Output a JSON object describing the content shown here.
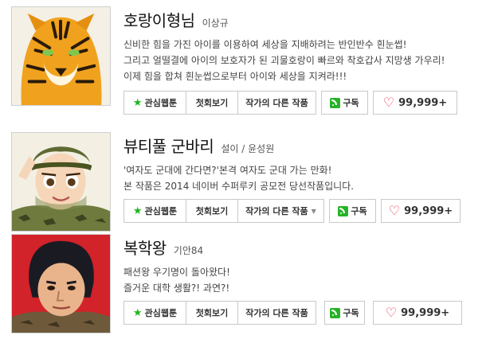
{
  "items": [
    {
      "title": "호랑이형님",
      "author": "이상규",
      "description": [
        "신비한 힘을 가진 아이를 이용하여 세상을 지배하려는 반인반수 흰눈썹!",
        "그리고 얼떨결에 아이의 보호자가 된 괴물호랑이 빠르와 착호갑사 지망생 가우리!",
        "이제 힘을 합쳐 흰눈썹으로부터 아이와 세상을 지켜라!!!"
      ],
      "buttons": {
        "favorite": "관심웹툰",
        "first_episode": "첫회보기",
        "other_works": "작가의 다른 작품",
        "subscribe": "구독",
        "likes": "99,999+"
      }
    },
    {
      "title": "뷰티풀 군바리",
      "author": "설이 / 윤성원",
      "description": [
        "'여자도 군대에 간다면?'본격 여자도 군대 가는 만화!",
        "본 작품은 2014 네이버 수퍼루키 공모전 당선작품입니다."
      ],
      "buttons": {
        "favorite": "관심웹툰",
        "first_episode": "첫회보기",
        "other_works": "작가의 다른 작품",
        "subscribe": "구독",
        "likes": "99,999+"
      }
    },
    {
      "title": "복학왕",
      "author": "기안84",
      "description": [
        "패션왕 우기명이 돌아왔다!",
        "즐거운 대학 생활?! 과연?!"
      ],
      "buttons": {
        "favorite": "관심웹툰",
        "first_episode": "첫회보기",
        "other_works": "작가의 다른 작품",
        "subscribe": "구독",
        "likes": "99,999+"
      }
    }
  ]
}
